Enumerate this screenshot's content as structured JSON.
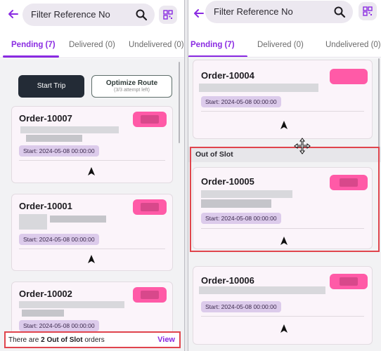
{
  "colors": {
    "accent": "#8a2be2",
    "status_pill": "#ff5aa7",
    "highlight_box": "#e0454d",
    "start_trip_bg": "#232b36"
  },
  "left": {
    "search": {
      "placeholder": "Filter Reference No"
    },
    "tabs": [
      {
        "label": "Pending (7)",
        "active": true
      },
      {
        "label": "Delivered (0)",
        "active": false
      },
      {
        "label": "Undelivered (0)",
        "active": false
      }
    ],
    "actions": {
      "start_trip": "Start Trip",
      "optimize_route": "Optimize Route",
      "optimize_attempts": "(3/3 attempt left)"
    },
    "orders": [
      {
        "id": "Order-10007",
        "start": "Start: 2024-05-08 00:00:00"
      },
      {
        "id": "Order-10001",
        "start": "Start: 2024-05-08 00:00:00"
      },
      {
        "id": "Order-10002",
        "start": "Start: 2024-05-08 00:00:00"
      }
    ],
    "banner": {
      "prefix": "There are ",
      "count_text": "2 Out of Slot",
      "suffix": " orders",
      "action": "View"
    }
  },
  "right": {
    "search": {
      "placeholder": "Filter Reference No"
    },
    "tabs": [
      {
        "label": "Pending (7)",
        "active": true
      },
      {
        "label": "Delivered (0)",
        "active": false
      },
      {
        "label": "Undelivered (0)",
        "active": false
      }
    ],
    "orders_top": [
      {
        "id": "Order-10004",
        "start": "Start: 2024-05-08 00:00:00"
      }
    ],
    "out_of_slot": {
      "title": "Out of Slot",
      "orders": [
        {
          "id": "Order-10005",
          "start": "Start: 2024-05-08 00:00:00"
        }
      ]
    },
    "orders_bottom": [
      {
        "id": "Order-10006",
        "start": "Start: 2024-05-08 00:00:00"
      }
    ]
  }
}
